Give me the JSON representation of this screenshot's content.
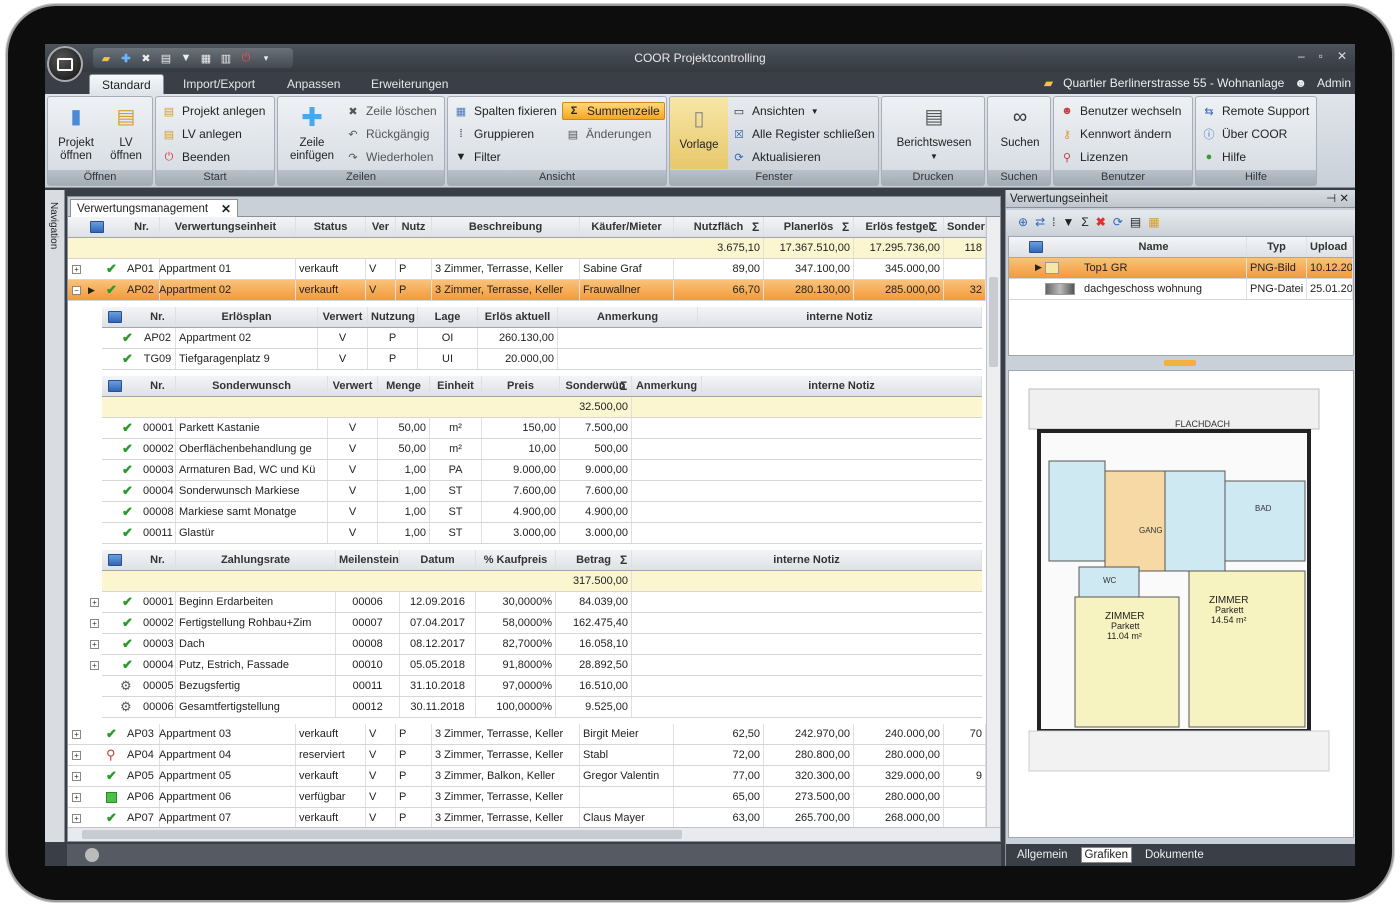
{
  "app": {
    "title": "COOR Projektcontrolling",
    "project": "Quartier Berlinerstrasse 55 - Wohnanlage",
    "user": "Admin"
  },
  "ribbon_tabs": [
    "Standard",
    "Import/Export",
    "Anpassen",
    "Erweiterungen"
  ],
  "groups": {
    "oeffnen": {
      "label": "Öffnen",
      "projekt_1": "Projekt",
      "projekt_2": "öffnen",
      "lv_1": "LV",
      "lv_2": "öffnen"
    },
    "start": {
      "label": "Start",
      "projekt_anlegen": "Projekt anlegen",
      "lv_anlegen": "LV anlegen",
      "beenden": "Beenden"
    },
    "zeilen": {
      "label": "Zeilen",
      "zeile_1": "Zeile",
      "zeile_2": "einfügen",
      "zeile_loeschen": "Zeile löschen",
      "rueckgaengig": "Rückgängig",
      "wiederholen": "Wiederholen"
    },
    "ansicht": {
      "label": "Ansicht",
      "spalten_fixieren": "Spalten fixieren",
      "summenzeile": "Summenzeile",
      "gruppieren": "Gruppieren",
      "aenderungen": "Änderungen",
      "filter": "Filter"
    },
    "fenster": {
      "label": "Fenster",
      "vorlage": "Vorlage",
      "ansichten": "Ansichten",
      "register": "Alle Register schließen",
      "aktualisieren": "Aktualisieren"
    },
    "drucken": {
      "label": "Drucken",
      "berichtswesen": "Berichtswesen"
    },
    "suchen": {
      "label": "Suchen",
      "suchen": "Suchen"
    },
    "benutzer": {
      "label": "Benutzer",
      "wechseln": "Benutzer wechseln",
      "kennwort": "Kennwort ändern",
      "lizenzen": "Lizenzen"
    },
    "hilfe": {
      "label": "Hilfe",
      "remote": "Remote Support",
      "ueber": "Über COOR",
      "hilfe": "Hilfe"
    }
  },
  "nav_label": "Navigation",
  "doc_tab": "Verwertungsmanagement",
  "main_table": {
    "headers": [
      "Nr.",
      "Verwertungseinheit",
      "Status",
      "Ver",
      "Nutz",
      "Beschreibung",
      "Käufer/Mieter",
      "Nutzfläch",
      "Planerlös",
      "Erlös festgel",
      "Sonderwi"
    ],
    "sums": [
      "3.675,10",
      "17.367.510,00",
      "17.295.736,00",
      "118"
    ],
    "rows": [
      [
        "AP01",
        "Appartment 01",
        "verkauft",
        "V",
        "P",
        "3 Zimmer, Terrasse, Keller",
        "Sabine Graf",
        "89,00",
        "347.100,00",
        "345.000,00",
        ""
      ],
      [
        "AP02",
        "Appartment 02",
        "verkauft",
        "V",
        "P",
        "3 Zimmer, Terrasse, Keller",
        "Frauwallner",
        "66,70",
        "280.130,00",
        "285.000,00",
        "32"
      ]
    ],
    "rows_bottom": [
      [
        "AP03",
        "Appartment 03",
        "verkauft",
        "V",
        "P",
        "3 Zimmer, Terrasse, Keller",
        "Birgit Meier",
        "62,50",
        "242.970,00",
        "240.000,00",
        "70"
      ],
      [
        "AP04",
        "Appartment 04",
        "reserviert",
        "V",
        "P",
        "3 Zimmer, Terrasse, Keller",
        "Stabl",
        "72,00",
        "280.800,00",
        "280.000,00",
        ""
      ],
      [
        "AP05",
        "Appartment 05",
        "verkauft",
        "V",
        "P",
        "3 Zimmer, Balkon, Keller",
        "Gregor Valentin",
        "77,00",
        "320.300,00",
        "329.000,00",
        "9"
      ],
      [
        "AP06",
        "Appartment 06",
        "verfügbar",
        "V",
        "P",
        "3 Zimmer, Terrasse, Keller",
        "",
        "65,00",
        "273.500,00",
        "280.000,00",
        ""
      ],
      [
        "AP07",
        "Appartment 07",
        "verkauft",
        "V",
        "P",
        "3 Zimmer, Terrasse, Keller",
        "Claus Mayer",
        "63,00",
        "265.700,00",
        "268.000,00",
        ""
      ]
    ]
  },
  "erloes_table": {
    "headers": [
      "Nr.",
      "Erlösplan",
      "Verwert",
      "Nutzung",
      "Lage",
      "Erlös aktuell",
      "Anmerkung",
      "interne Notiz"
    ],
    "rows": [
      [
        "AP02",
        "Appartment 02",
        "V",
        "P",
        "OI",
        "260.130,00"
      ],
      [
        "TG09",
        "Tiefgaragenplatz 9",
        "V",
        "P",
        "UI",
        "20.000,00"
      ]
    ]
  },
  "sonder_table": {
    "headers": [
      "Nr.",
      "Sonderwunsch",
      "Verwert",
      "Menge",
      "Einheit",
      "Preis",
      "Sonderwün",
      "Anmerkung",
      "interne Notiz"
    ],
    "sum": "32.500,00",
    "rows": [
      [
        "00001",
        "Parkett Kastanie",
        "V",
        "50,00",
        "m²",
        "150,00",
        "7.500,00"
      ],
      [
        "00002",
        "Oberflächenbehandlung ge",
        "V",
        "50,00",
        "m²",
        "10,00",
        "500,00"
      ],
      [
        "00003",
        "Armaturen Bad, WC und Kü",
        "V",
        "1,00",
        "PA",
        "9.000,00",
        "9.000,00"
      ],
      [
        "00004",
        "Sonderwunsch Markiese",
        "V",
        "1,00",
        "ST",
        "7.600,00",
        "7.600,00"
      ],
      [
        "00008",
        "Markiese samt Monatge",
        "V",
        "1,00",
        "ST",
        "4.900,00",
        "4.900,00"
      ],
      [
        "00011",
        "Glastür",
        "V",
        "1,00",
        "ST",
        "3.000,00",
        "3.000,00"
      ]
    ]
  },
  "zahlung_table": {
    "headers": [
      "Nr.",
      "Zahlungsrate",
      "Meilenstein",
      "Datum",
      "% Kaufpreis",
      "Betrag",
      "interne Notiz"
    ],
    "sum": "317.500,00",
    "rows": [
      [
        "00001",
        "Beginn Erdarbeiten",
        "00006",
        "12.09.2016",
        "30,0000%",
        "84.039,00"
      ],
      [
        "00002",
        "Fertigstellung Rohbau+Zim",
        "00007",
        "07.04.2017",
        "58,0000%",
        "162.475,40"
      ],
      [
        "00003",
        "Dach",
        "00008",
        "08.12.2017",
        "82,7000%",
        "16.058,10"
      ],
      [
        "00004",
        "Putz, Estrich, Fassade",
        "00010",
        "05.05.2018",
        "91,8000%",
        "28.892,50"
      ],
      [
        "00005",
        "Bezugsfertig",
        "00011",
        "31.10.2018",
        "97,0000%",
        "16.510,00"
      ],
      [
        "00006",
        "Gesamtfertigstellung",
        "00012",
        "30.11.2018",
        "100,0000%",
        "9.525,00"
      ]
    ]
  },
  "right_panel": {
    "title": "Verwertungseinheit",
    "headers": [
      "Name",
      "Typ",
      "Upload"
    ],
    "rows": [
      [
        "Top1 GR",
        "PNG-Bild",
        "10.12.20"
      ],
      [
        "dachgeschoss wohnung",
        "PNG-Datei",
        "25.01.20"
      ]
    ],
    "plan": {
      "flachdach": "FLACHDACH",
      "zimmer1": "ZIMMER",
      "parkett1": "Parkett",
      "area1": "11.04 m²",
      "zimmer2": "ZIMMER",
      "parkett2": "Parkett",
      "area2": "14.54 m²",
      "bad": "BAD",
      "gang": "GANG",
      "wc": "WC"
    },
    "bottom_tabs": [
      "Allgemein",
      "Grafiken",
      "Dokumente"
    ]
  },
  "colors": {
    "accent": "#f39a3a",
    "check": "#2a9a2a",
    "sum_row": "#fbf6cf"
  }
}
